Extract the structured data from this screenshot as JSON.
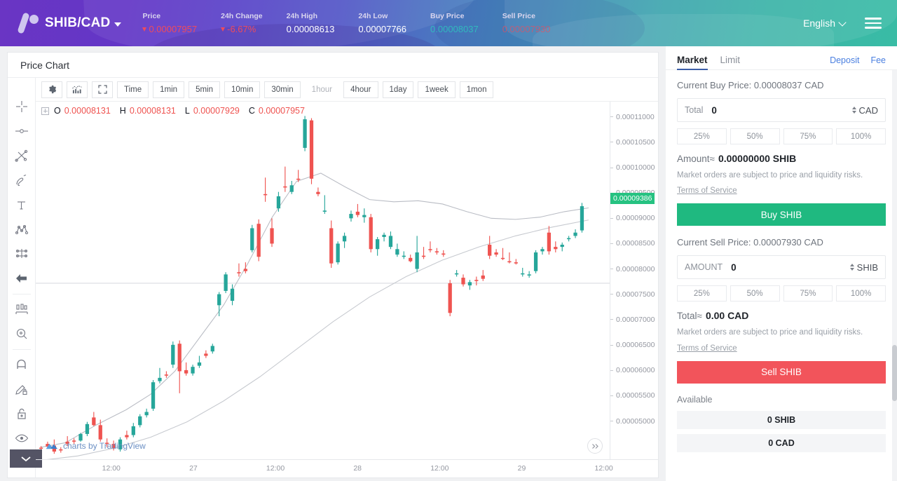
{
  "header": {
    "logo_icon": "vircurex-logo-icon",
    "pair": "SHIB/CAD",
    "pair_caret_icon": "caret-down-icon",
    "stats": [
      {
        "label": "Price",
        "value": "0.00007957",
        "trend": "down",
        "style": "down-arrow"
      },
      {
        "label": "24h Change",
        "value": "-6.67%",
        "trend": "down",
        "style": "down-arrow"
      },
      {
        "label": "24h High",
        "value": "0.00008613",
        "trend": "none",
        "style": "plain"
      },
      {
        "label": "24h Low",
        "value": "0.00007766",
        "trend": "none",
        "style": "plain"
      },
      {
        "label": "Buy Price",
        "value": "0.00008037",
        "trend": "none",
        "style": "buy"
      },
      {
        "label": "Sell Price",
        "value": "0.00007930",
        "trend": "none",
        "style": "sell"
      }
    ],
    "language": "English",
    "language_caret_icon": "chevron-down-icon",
    "menu_icon": "hamburger-menu-icon"
  },
  "chart": {
    "title": "Price Chart",
    "left_tools": [
      "crosshair-icon",
      "dot-line-icon",
      "trend-line-icon",
      "brush-icon",
      "text-tool-icon",
      "pattern-icon",
      "forecast-icon",
      "arrow-back-icon",
      "measure-icon",
      "zoom-in-icon",
      "magnet-icon",
      "pencil-lock-icon",
      "lock-icon",
      "eye-icon"
    ],
    "collapse_icon": "chevron-down-icon",
    "toolbar_icons": [
      "gear-icon",
      "indicators-chart-icon",
      "fullscreen-icon"
    ],
    "timeframes": [
      {
        "label": "Time",
        "active": false
      },
      {
        "label": "1min",
        "active": false
      },
      {
        "label": "5min",
        "active": false
      },
      {
        "label": "10min",
        "active": false
      },
      {
        "label": "30min",
        "active": false
      },
      {
        "label": "1hour",
        "active": true
      },
      {
        "label": "4hour",
        "active": false
      },
      {
        "label": "1day",
        "active": false
      },
      {
        "label": "1week",
        "active": false
      },
      {
        "label": "1mon",
        "active": false
      }
    ],
    "ohlc": {
      "open_key": "O",
      "open": "0.00008131",
      "high_key": "H",
      "high": "0.00008131",
      "low_key": "L",
      "low": "0.00007929",
      "close_key": "C",
      "close": "0.00007957"
    },
    "current_price_badge": "0.00009386",
    "credit": "charts by TradingView",
    "credit_icon": "tradingview-logo-icon",
    "scroll_forward_icon": "double-chevron-right-icon"
  },
  "chart_data": {
    "type": "candlestick",
    "title": "Price Chart",
    "symbol": "SHIB/CAD",
    "interval": "1hour",
    "xlabel": "",
    "ylabel": "",
    "ylim": [
      4.8e-05,
      0.000113
    ],
    "y_ticks": [
      "0.00011000",
      "0.00010500",
      "0.00010000",
      "0.00009500",
      "0.00009000",
      "0.00008500",
      "0.00008000",
      "0.00007500",
      "0.00007000",
      "0.00006500",
      "0.00006000",
      "0.00005500",
      "0.00005000"
    ],
    "x_ticks": [
      "12:00",
      "27",
      "12:00",
      "28",
      "12:00",
      "29",
      "12:00"
    ],
    "grid": false,
    "legend": "none",
    "up_color": "#26a69a",
    "down_color": "#ef5350",
    "last_price": 9.386e-05,
    "overlays": [
      {
        "name": "ma-fast",
        "color": "#b9bcc4",
        "points": [
          [
            0,
            5.02e-05
          ],
          [
            4,
            5.1e-05
          ],
          [
            9,
            5.42e-05
          ],
          [
            14,
            5.7e-05
          ],
          [
            18,
            5.98e-05
          ],
          [
            22,
            6.4e-05
          ],
          [
            26,
            7e-05
          ],
          [
            30,
            7.6e-05
          ],
          [
            34,
            8.36e-05
          ],
          [
            38,
            9.2e-05
          ],
          [
            42,
            9.85e-05
          ],
          [
            46,
            0.0001
          ],
          [
            50,
            9.75e-05
          ],
          [
            54,
            9.52e-05
          ],
          [
            58,
            9.48e-05
          ],
          [
            62,
            9.5e-05
          ],
          [
            66,
            9.44e-05
          ],
          [
            70,
            9.3e-05
          ],
          [
            74,
            9.18e-05
          ],
          [
            78,
            9.16e-05
          ],
          [
            82,
            9.2e-05
          ],
          [
            86,
            9.3e-05
          ],
          [
            90,
            9.37e-05
          ]
        ]
      },
      {
        "name": "ma-slow",
        "color": "#c6c9cf",
        "points": [
          [
            0,
            4.78e-05
          ],
          [
            6,
            4.86e-05
          ],
          [
            12,
            5e-05
          ],
          [
            18,
            5.2e-05
          ],
          [
            24,
            5.48e-05
          ],
          [
            30,
            5.86e-05
          ],
          [
            36,
            6.3e-05
          ],
          [
            42,
            6.8e-05
          ],
          [
            48,
            7.3e-05
          ],
          [
            54,
            7.75e-05
          ],
          [
            60,
            8.12e-05
          ],
          [
            66,
            8.42e-05
          ],
          [
            72,
            8.66e-05
          ],
          [
            78,
            8.86e-05
          ],
          [
            84,
            9.02e-05
          ],
          [
            90,
            9.15e-05
          ]
        ]
      }
    ],
    "candles": [
      {
        "o": 5e-05,
        "h": 5.04e-05,
        "l": 4.98e-05,
        "c": 5.01e-05,
        "dir": "down"
      },
      {
        "o": 5.08e-05,
        "h": 5.12e-05,
        "l": 5e-05,
        "c": 5.03e-05,
        "dir": "down"
      },
      {
        "o": 5.05e-05,
        "h": 5.16e-05,
        "l": 4.9e-05,
        "c": 4.94e-05,
        "dir": "down"
      },
      {
        "o": 4.96e-05,
        "h": 5.02e-05,
        "l": 4.92e-05,
        "c": 4.98e-05,
        "dir": "down"
      },
      {
        "o": 5.08e-05,
        "h": 5.22e-05,
        "l": 5.04e-05,
        "c": 5.12e-05,
        "dir": "down"
      },
      {
        "o": 5.12e-05,
        "h": 5.18e-05,
        "l": 5.08e-05,
        "c": 5.14e-05,
        "dir": "down"
      },
      {
        "o": 5.14e-05,
        "h": 5.28e-05,
        "l": 5.12e-05,
        "c": 5.26e-05,
        "dir": "up"
      },
      {
        "o": 5.26e-05,
        "h": 5.48e-05,
        "l": 5.22e-05,
        "c": 5.44e-05,
        "dir": "up"
      },
      {
        "o": 5.56e-05,
        "h": 5.66e-05,
        "l": 5.4e-05,
        "c": 5.42e-05,
        "dir": "down"
      },
      {
        "o": 5.42e-05,
        "h": 5.52e-05,
        "l": 5.12e-05,
        "c": 5.16e-05,
        "dir": "down"
      },
      {
        "o": 5.08e-05,
        "h": 5.18e-05,
        "l": 5.02e-05,
        "c": 5.1e-05,
        "dir": "down"
      },
      {
        "o": 5.08e-05,
        "h": 5.14e-05,
        "l": 4.96e-05,
        "c": 5e-05,
        "dir": "down"
      },
      {
        "o": 4.98e-05,
        "h": 5.2e-05,
        "l": 4.94e-05,
        "c": 5.16e-05,
        "dir": "up"
      },
      {
        "o": 5.2e-05,
        "h": 5.32e-05,
        "l": 5.16e-05,
        "c": 5.24e-05,
        "dir": "down"
      },
      {
        "o": 5.24e-05,
        "h": 5.46e-05,
        "l": 5.2e-05,
        "c": 5.4e-05,
        "dir": "up"
      },
      {
        "o": 5.42e-05,
        "h": 5.62e-05,
        "l": 5.38e-05,
        "c": 5.58e-05,
        "dir": "up"
      },
      {
        "o": 5.6e-05,
        "h": 5.72e-05,
        "l": 5.56e-05,
        "c": 5.66e-05,
        "dir": "up"
      },
      {
        "o": 5.72e-05,
        "h": 6.24e-05,
        "l": 5.68e-05,
        "c": 6.2e-05,
        "dir": "up"
      },
      {
        "o": 6.22e-05,
        "h": 6.46e-05,
        "l": 6.18e-05,
        "c": 6.28e-05,
        "dir": "up"
      },
      {
        "o": 6.34e-05,
        "h": 6.4e-05,
        "l": 6.28e-05,
        "c": 6.32e-05,
        "dir": "down"
      },
      {
        "o": 6.52e-05,
        "h": 6.94e-05,
        "l": 6.46e-05,
        "c": 6.88e-05,
        "dir": "up"
      },
      {
        "o": 6.9e-05,
        "h": 6.96e-05,
        "l": 6e-05,
        "c": 6.4e-05,
        "dir": "down"
      },
      {
        "o": 6.42e-05,
        "h": 6.56e-05,
        "l": 6.32e-05,
        "c": 6.36e-05,
        "dir": "down"
      },
      {
        "o": 6.36e-05,
        "h": 6.52e-05,
        "l": 6.32e-05,
        "c": 6.48e-05,
        "dir": "up"
      },
      {
        "o": 6.5e-05,
        "h": 6.68e-05,
        "l": 6.46e-05,
        "c": 6.56e-05,
        "dir": "up"
      },
      {
        "o": 6.68e-05,
        "h": 6.78e-05,
        "l": 6.64e-05,
        "c": 6.72e-05,
        "dir": "down"
      },
      {
        "o": 6.76e-05,
        "h": 6.9e-05,
        "l": 6.72e-05,
        "c": 6.86e-05,
        "dir": "up"
      },
      {
        "o": 7.6e-05,
        "h": 7.84e-05,
        "l": 7.4e-05,
        "c": 7.8e-05,
        "dir": "up"
      },
      {
        "o": 7.86e-05,
        "h": 8.2e-05,
        "l": 7.82e-05,
        "c": 8.16e-05,
        "dir": "up"
      },
      {
        "o": 7.9e-05,
        "h": 7.98e-05,
        "l": 7.6e-05,
        "c": 7.68e-05,
        "dir": "up"
      },
      {
        "o": 8.18e-05,
        "h": 8.36e-05,
        "l": 8.12e-05,
        "c": 8.2e-05,
        "dir": "down"
      },
      {
        "o": 8.22e-05,
        "h": 8.38e-05,
        "l": 8.18e-05,
        "c": 8.26e-05,
        "dir": "down"
      },
      {
        "o": 8.6e-05,
        "h": 9.06e-05,
        "l": 8.56e-05,
        "c": 9e-05,
        "dir": "up"
      },
      {
        "o": 9.08e-05,
        "h": 9.16e-05,
        "l": 8.4e-05,
        "c": 8.48e-05,
        "dir": "down"
      },
      {
        "o": 9.6e-05,
        "h": 9.92e-05,
        "l": 9.48e-05,
        "c": 9.62e-05,
        "dir": "down"
      },
      {
        "o": 9e-05,
        "h": 9.18e-05,
        "l": 8.66e-05,
        "c": 8.72e-05,
        "dir": "down"
      },
      {
        "o": 9.36e-05,
        "h": 9.66e-05,
        "l": 9.3e-05,
        "c": 9.58e-05,
        "dir": "up"
      },
      {
        "o": 9.76e-05,
        "h": 0.0001012,
        "l": 9.66e-05,
        "c": 9.74e-05,
        "dir": "down"
      },
      {
        "o": 9.66e-05,
        "h": 9.86e-05,
        "l": 9.62e-05,
        "c": 9.78e-05,
        "dir": "up"
      },
      {
        "o": 9.88e-05,
        "h": 0.0001006,
        "l": 9.84e-05,
        "c": 9.9e-05,
        "dir": "down"
      },
      {
        "o": 0.0001046,
        "h": 0.0001104,
        "l": 0.000104,
        "c": 0.0001098,
        "dir": "up"
      },
      {
        "o": 0.0001096,
        "h": 0.00011,
        "l": 9.8e-05,
        "c": 9.9e-05,
        "dir": "down"
      },
      {
        "o": 9.66e-05,
        "h": 9.74e-05,
        "l": 9.58e-05,
        "c": 9.62e-05,
        "dir": "down"
      },
      {
        "o": 9.32e-05,
        "h": 9.6e-05,
        "l": 9.26e-05,
        "c": 9.3e-05,
        "dir": "up"
      },
      {
        "o": 9e-05,
        "h": 9.14e-05,
        "l": 8.28e-05,
        "c": 8.36e-05,
        "dir": "down"
      },
      {
        "o": 8.38e-05,
        "h": 8.76e-05,
        "l": 8.34e-05,
        "c": 8.72e-05,
        "dir": "up"
      },
      {
        "o": 8.76e-05,
        "h": 8.92e-05,
        "l": 8.64e-05,
        "c": 8.86e-05,
        "dir": "up"
      },
      {
        "o": 9.18e-05,
        "h": 9.32e-05,
        "l": 9.12e-05,
        "c": 9.26e-05,
        "dir": "up"
      },
      {
        "o": 9.3e-05,
        "h": 9.44e-05,
        "l": 9.2e-05,
        "c": 9.24e-05,
        "dir": "down"
      },
      {
        "o": 9.24e-05,
        "h": 9.36e-05,
        "l": 9.1e-05,
        "c": 9.2e-05,
        "dir": "up"
      },
      {
        "o": 9.2e-05,
        "h": 9.26e-05,
        "l": 8.56e-05,
        "c": 8.62e-05,
        "dir": "down"
      },
      {
        "o": 8.62e-05,
        "h": 8.84e-05,
        "l": 8.5e-05,
        "c": 8.8e-05,
        "dir": "up"
      },
      {
        "o": 8.84e-05,
        "h": 8.92e-05,
        "l": 8.76e-05,
        "c": 8.88e-05,
        "dir": "up"
      },
      {
        "o": 8.86e-05,
        "h": 8.94e-05,
        "l": 8.62e-05,
        "c": 8.66e-05,
        "dir": "up"
      },
      {
        "o": 8.62e-05,
        "h": 8.72e-05,
        "l": 8.48e-05,
        "c": 8.52e-05,
        "dir": "up"
      },
      {
        "o": 8.5e-05,
        "h": 8.58e-05,
        "l": 8.44e-05,
        "c": 8.48e-05,
        "dir": "up"
      },
      {
        "o": 8.46e-05,
        "h": 8.52e-05,
        "l": 8.38e-05,
        "c": 8.4e-05,
        "dir": "down"
      },
      {
        "o": 8.56e-05,
        "h": 8.86e-05,
        "l": 8.2e-05,
        "c": 8.26e-05,
        "dir": "up"
      },
      {
        "o": 8.5e-05,
        "h": 8.66e-05,
        "l": 8.44e-05,
        "c": 8.48e-05,
        "dir": "down"
      },
      {
        "o": 8.62e-05,
        "h": 8.76e-05,
        "l": 8.56e-05,
        "c": 8.6e-05,
        "dir": "down"
      },
      {
        "o": 8.58e-05,
        "h": 8.64e-05,
        "l": 8.52e-05,
        "c": 8.56e-05,
        "dir": "down"
      },
      {
        "o": 8.54e-05,
        "h": 8.6e-05,
        "l": 8.48e-05,
        "c": 8.52e-05,
        "dir": "down"
      },
      {
        "o": 8e-05,
        "h": 8.06e-05,
        "l": 7.4e-05,
        "c": 7.46e-05,
        "dir": "down"
      },
      {
        "o": 8.16e-05,
        "h": 8.24e-05,
        "l": 8.12e-05,
        "c": 8.18e-05,
        "dir": "up"
      },
      {
        "o": 8.1e-05,
        "h": 8.16e-05,
        "l": 7.94e-05,
        "c": 7.98e-05,
        "dir": "down"
      },
      {
        "o": 7.96e-05,
        "h": 8.06e-05,
        "l": 7.88e-05,
        "c": 8.02e-05,
        "dir": "up"
      },
      {
        "o": 8.04e-05,
        "h": 8.12e-05,
        "l": 7.96e-05,
        "c": 8.06e-05,
        "dir": "down"
      },
      {
        "o": 8.08e-05,
        "h": 8.24e-05,
        "l": 8.04e-05,
        "c": 8.14e-05,
        "dir": "down"
      },
      {
        "o": 8.7e-05,
        "h": 8.86e-05,
        "l": 8.44e-05,
        "c": 8.5e-05,
        "dir": "down"
      },
      {
        "o": 8.56e-05,
        "h": 8.62e-05,
        "l": 8.48e-05,
        "c": 8.52e-05,
        "dir": "down"
      },
      {
        "o": 8.46e-05,
        "h": 8.64e-05,
        "l": 8.42e-05,
        "c": 8.46e-05,
        "dir": "down"
      },
      {
        "o": 8.4e-05,
        "h": 8.56e-05,
        "l": 8.36e-05,
        "c": 8.38e-05,
        "dir": "down"
      },
      {
        "o": 8.38e-05,
        "h": 8.44e-05,
        "l": 8.34e-05,
        "c": 8.36e-05,
        "dir": "down"
      },
      {
        "o": 8.18e-05,
        "h": 8.28e-05,
        "l": 8.12e-05,
        "c": 8.16e-05,
        "dir": "up"
      },
      {
        "o": 8.16e-05,
        "h": 8.22e-05,
        "l": 8.1e-05,
        "c": 8.14e-05,
        "dir": "up"
      },
      {
        "o": 8.22e-05,
        "h": 8.6e-05,
        "l": 8.18e-05,
        "c": 8.56e-05,
        "dir": "up"
      },
      {
        "o": 8.58e-05,
        "h": 8.66e-05,
        "l": 8.52e-05,
        "c": 8.62e-05,
        "dir": "up"
      },
      {
        "o": 8.92e-05,
        "h": 9.04e-05,
        "l": 8.52e-05,
        "c": 8.58e-05,
        "dir": "down"
      },
      {
        "o": 8.62e-05,
        "h": 8.76e-05,
        "l": 8.56e-05,
        "c": 8.66e-05,
        "dir": "down"
      },
      {
        "o": 8.66e-05,
        "h": 8.74e-05,
        "l": 8.58e-05,
        "c": 8.7e-05,
        "dir": "up"
      },
      {
        "o": 8.8e-05,
        "h": 8.86e-05,
        "l": 8.76e-05,
        "c": 8.82e-05,
        "dir": "up"
      },
      {
        "o": 8.86e-05,
        "h": 8.98e-05,
        "l": 8.82e-05,
        "c": 8.92e-05,
        "dir": "up"
      },
      {
        "o": 8.96e-05,
        "h": 9.46e-05,
        "l": 8.92e-05,
        "c": 9.4e-05,
        "dir": "up"
      }
    ]
  },
  "order": {
    "tabs": [
      {
        "label": "Market",
        "active": true
      },
      {
        "label": "Limit",
        "active": false
      }
    ],
    "links": [
      "Deposit",
      "Fee"
    ],
    "buy": {
      "current_price_text": "Current Buy Price: 0.00008037 CAD",
      "field_label": "Total",
      "field_value": "0",
      "field_unit": "CAD",
      "stepper_icon": "stepper-updown-icon",
      "percents": [
        "25%",
        "50%",
        "75%",
        "100%"
      ],
      "approx_label": "Amount≈",
      "approx_value": "0.00000000 SHIB",
      "disclaimer": "Market orders are subject to price and liquidity risks.",
      "tos": "Terms of Service",
      "cta": "Buy SHIB"
    },
    "sell": {
      "current_price_text": "Current Sell Price: 0.00007930 CAD",
      "field_label": "AMOUNT",
      "field_value": "0",
      "field_unit": "SHIB",
      "stepper_icon": "stepper-updown-icon",
      "percents": [
        "25%",
        "50%",
        "75%",
        "100%"
      ],
      "approx_label": "Total≈",
      "approx_value": "0.00 CAD",
      "disclaimer": "Market orders are subject to price and liquidity risks.",
      "tos": "Terms of Service",
      "cta": "Sell SHIB"
    },
    "available_label": "Available",
    "balances": [
      "0 SHIB",
      "0 CAD"
    ]
  }
}
